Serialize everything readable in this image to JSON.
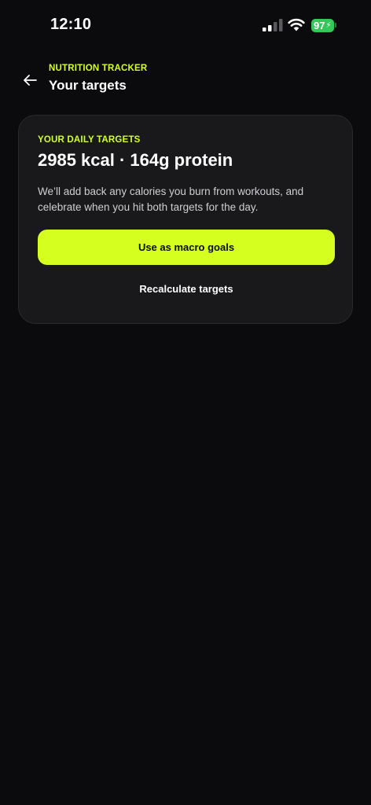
{
  "status_bar": {
    "time": "12:10",
    "battery": "97",
    "battery_color": "#34c759"
  },
  "icons": {
    "back": "back-arrow-icon",
    "signal": "cellular-signal-icon",
    "wifi": "wifi-icon",
    "battery": "battery-icon",
    "charging": "lightning-bolt-icon"
  },
  "header": {
    "eyebrow": "NUTRITION TRACKER",
    "title": "Your targets"
  },
  "card": {
    "eyebrow": "YOUR DAILY TARGETS",
    "headline": "2985 kcal · 164g protein",
    "body": "We’ll add back any calories you burn from workouts, and celebrate when you hit both targets for the day.",
    "primary_button": "Use as macro goals",
    "secondary_button": "Recalculate targets"
  },
  "colors": {
    "accent": "#d4ff1f",
    "background": "#0b0b0d",
    "card": "#19191b"
  }
}
